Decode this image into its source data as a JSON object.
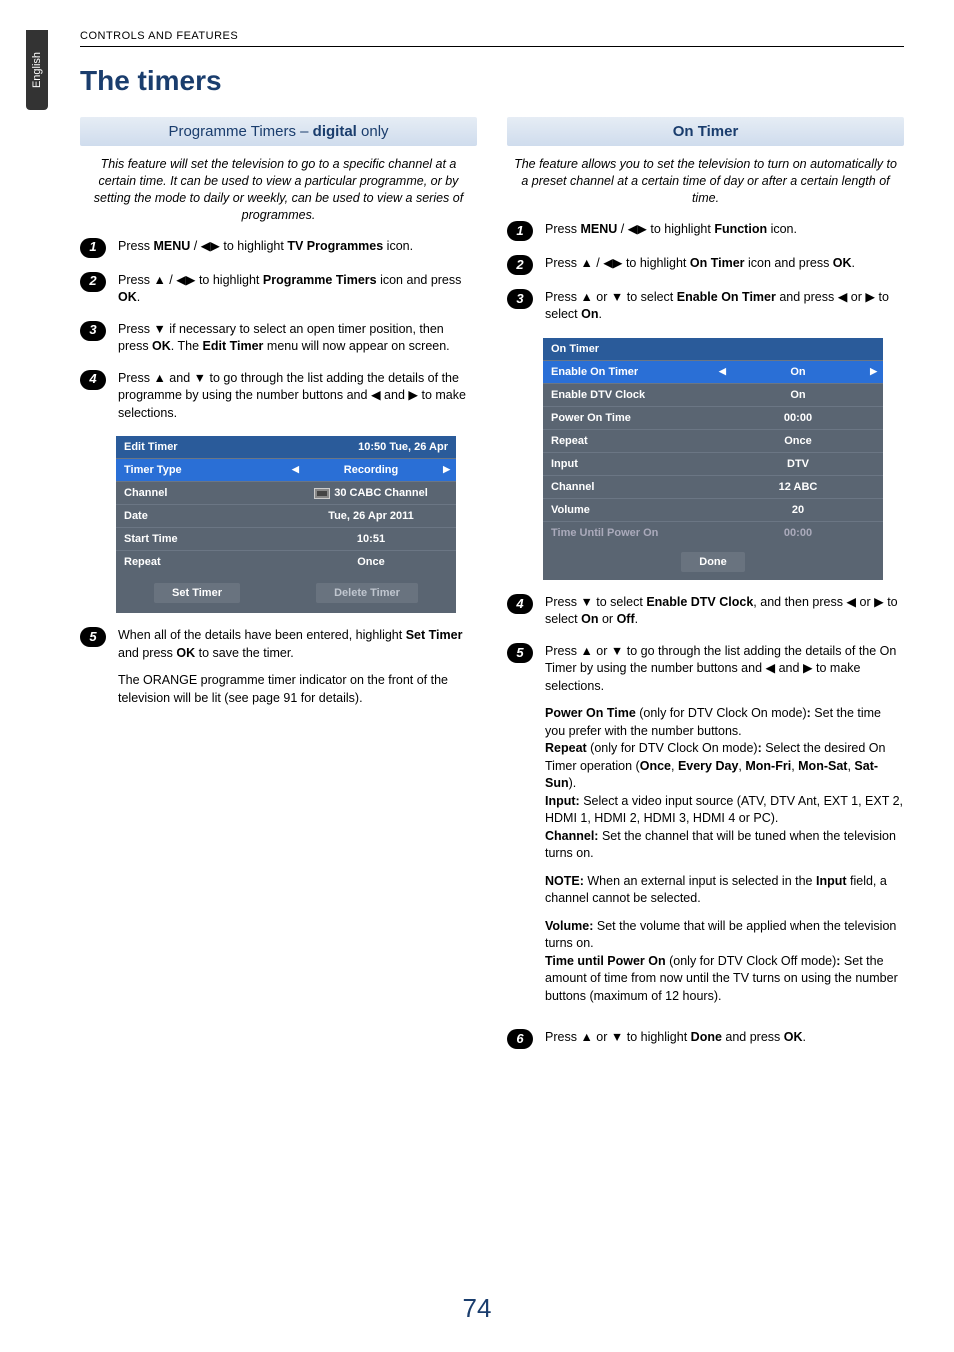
{
  "header": "CONTROLS AND FEATURES",
  "lang_tab": "English",
  "title": "The timers",
  "page_number": "74",
  "glyphs": {
    "left": "◀",
    "right": "▶",
    "up": "▲",
    "down": "▼",
    "lr": "◀▶"
  },
  "left": {
    "section_title_a": "Programme Timers – ",
    "section_title_b": "digital",
    "section_title_c": " only",
    "intro": "This feature will set the television to go to a specific channel at a certain time. It can be used to view a particular programme, or by setting the mode to daily or weekly, can be used to view a series of programmes.",
    "steps": {
      "s1": {
        "n": "1",
        "a": "Press ",
        "b": "MENU",
        "c": " / ",
        "d": " to highlight ",
        "e": "TV Programmes",
        "f": " icon."
      },
      "s2": {
        "n": "2",
        "a": "Press ",
        "b": " / ",
        "c": " to highlight ",
        "d": "Programme Timers",
        "e": "  icon and press ",
        "f": "OK",
        "g": "."
      },
      "s3": {
        "n": "3",
        "a": "Press ",
        "b": " if necessary to select an open timer position, then press ",
        "c": "OK",
        "d": ". The ",
        "e": "Edit Timer",
        "f": " menu will now appear on screen."
      },
      "s4": {
        "n": "4",
        "a": "Press ",
        "b": " and ",
        "c": " to go through the list adding the details of the programme by using the number buttons and ",
        "d": " and ",
        "e": " to make selections."
      },
      "s5": {
        "n": "5",
        "a": "When all of the details have been entered, highlight ",
        "b": "Set Timer",
        "c": " and press ",
        "d": "OK",
        "e": " to save the timer."
      }
    },
    "post": "The ORANGE programme timer indicator on the front of the television will be lit (see page 91 for details).",
    "table": {
      "header_l": "Edit Timer",
      "header_r": "10:50 Tue, 26 Apr",
      "rows": [
        {
          "l": "Timer Type",
          "r": "Recording",
          "sel": true,
          "arrows": true
        },
        {
          "l": "Channel",
          "r": "30 CABC Channel",
          "icon": true
        },
        {
          "l": "Date",
          "r": "Tue, 26 Apr 2011"
        },
        {
          "l": "Start Time",
          "r": "10:51"
        },
        {
          "l": "Repeat",
          "r": "Once"
        }
      ],
      "btn1": "Set Timer",
      "btn2": "Delete Timer"
    }
  },
  "right": {
    "section_title": "On Timer",
    "intro": "The feature allows you to set the television to turn on automatically to a preset channel at a certain time of day or after a certain length of time.",
    "steps": {
      "s1": {
        "n": "1",
        "a": "Press ",
        "b": "MENU",
        "c": " / ",
        "d": " to highlight ",
        "e": "Function",
        "f": " icon."
      },
      "s2": {
        "n": "2",
        "a": "Press ",
        "b": " / ",
        "c": " to highlight ",
        "d": "On Timer",
        "e": " icon and press ",
        "f": "OK",
        "g": "."
      },
      "s3": {
        "n": "3",
        "a": "Press ",
        "b": " or ",
        "c": " to select ",
        "d": "Enable On Timer",
        "e": " and press ",
        "f": " or ",
        "g": " to select ",
        "h": "On",
        "i": "."
      },
      "s4": {
        "n": "4",
        "a": "Press ",
        "b": " to select ",
        "c": "Enable DTV Clock",
        "d": ", and then press ",
        "e": " or ",
        "f": " to select ",
        "g": "On",
        "h": " or ",
        "i": "Off",
        "j": "."
      },
      "s5": {
        "n": "5",
        "a": "Press ",
        "b": " or ",
        "c": " to go through the list adding the details of the On Timer by using the number buttons and ",
        "d": " and ",
        "e": " to make selections."
      },
      "s6": {
        "n": "6",
        "a": "Press ",
        "b": " or ",
        "c": " to highlight ",
        "d": "Done",
        "e": " and press ",
        "f": "OK",
        "g": "."
      }
    },
    "details": {
      "p1a": "Power On Time",
      "p1b": " (only for DTV Clock On mode)",
      "p1c": ": ",
      "p1d": "Set the time you prefer with the number buttons.",
      "p2a": "Repeat",
      "p2b": " (only for DTV Clock On mode)",
      "p2c": ": ",
      "p2d": "Select the desired On Timer operation (",
      "p2e": "Once",
      "p2f": ", ",
      "p2g": "Every Day",
      "p2h": ", ",
      "p2i": "Mon-Fri",
      "p2j": ", ",
      "p2k": "Mon-Sat",
      "p2l": ", ",
      "p2m": "Sat-Sun",
      "p2n": ").",
      "p3a": "Input:",
      "p3b": " Select a video input source (ATV, DTV Ant, EXT 1, EXT 2, HDMI 1, HDMI 2, HDMI 3, HDMI 4 or PC).",
      "p4a": "Channel:",
      "p4b": " Set the channel that will be tuned when the television turns on.",
      "p5a": "NOTE:",
      "p5b": " When an external input is selected in the ",
      "p5c": "Input",
      "p5d": " field, a channel cannot be selected.",
      "p6a": "Volume:",
      "p6b": " Set the volume that will be applied when the television turns on.",
      "p7a": "Time until Power On",
      "p7b": " (only for DTV Clock Off mode)",
      "p7c": ": ",
      "p7d": "Set the amount of time from now until the TV turns on using the number buttons (maximum of 12 hours)."
    },
    "table": {
      "header": "On Timer",
      "rows": [
        {
          "l": "Enable On Timer",
          "r": "On",
          "sel": true,
          "arrows": true
        },
        {
          "l": "Enable DTV Clock",
          "r": "On"
        },
        {
          "l": "Power On Time",
          "r": "00:00"
        },
        {
          "l": "Repeat",
          "r": "Once"
        },
        {
          "l": "Input",
          "r": "DTV"
        },
        {
          "l": "Channel",
          "r": "12 ABC"
        },
        {
          "l": "Volume",
          "r": "20"
        },
        {
          "l": "Time Until Power On",
          "r": "00:00",
          "dim": true
        }
      ],
      "done": "Done"
    }
  }
}
